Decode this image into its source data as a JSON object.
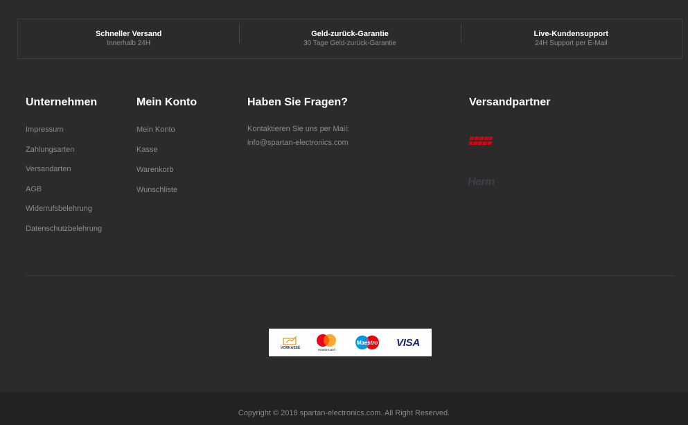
{
  "features": [
    {
      "title": "Schneller Versand",
      "subtitle": "Innerhalb 24H"
    },
    {
      "title": "Geld-zurück-Garantie",
      "subtitle": "30 Tage Geld-zurück-Garantie"
    },
    {
      "title": "Live-Kundensupport",
      "subtitle": "24H Support per E-Mail"
    }
  ],
  "columns": {
    "unternehmen": {
      "heading": "Unternehmen",
      "links": [
        "Impressum",
        "Zahlungsarten",
        "Versandarten",
        "AGB",
        "Widerrufsbelehrung",
        "Datenschutzbelehrung"
      ]
    },
    "konto": {
      "heading": "Mein Konto",
      "links": [
        "Mein Konto",
        "Kasse",
        "Warenkorb",
        "Wunschliste"
      ]
    },
    "fragen": {
      "heading": "Haben Sie Fragen?",
      "contact_line": "Kontaktieren Sie uns per Mail:",
      "email": "info@spartan-electronics.com"
    },
    "versand": {
      "heading": "Versandpartner",
      "partners": [
        "dhl-logo",
        "hermes-logo"
      ],
      "hermes_text": "Herm"
    }
  },
  "payments": {
    "vorkasse_label": "VORKASSE",
    "mastercard_label": "mastercard",
    "maestro_label": "Maestro",
    "visa_label": "VISA"
  },
  "copyright": "Copyright © 2018 spartan-electronics.com. All Right Reserved.",
  "colors": {
    "background": "#2b2b2b",
    "bottom_bar": "#222222",
    "heading": "#ffffff",
    "link": "#8c8c8c",
    "dhl_red": "#d40511"
  }
}
